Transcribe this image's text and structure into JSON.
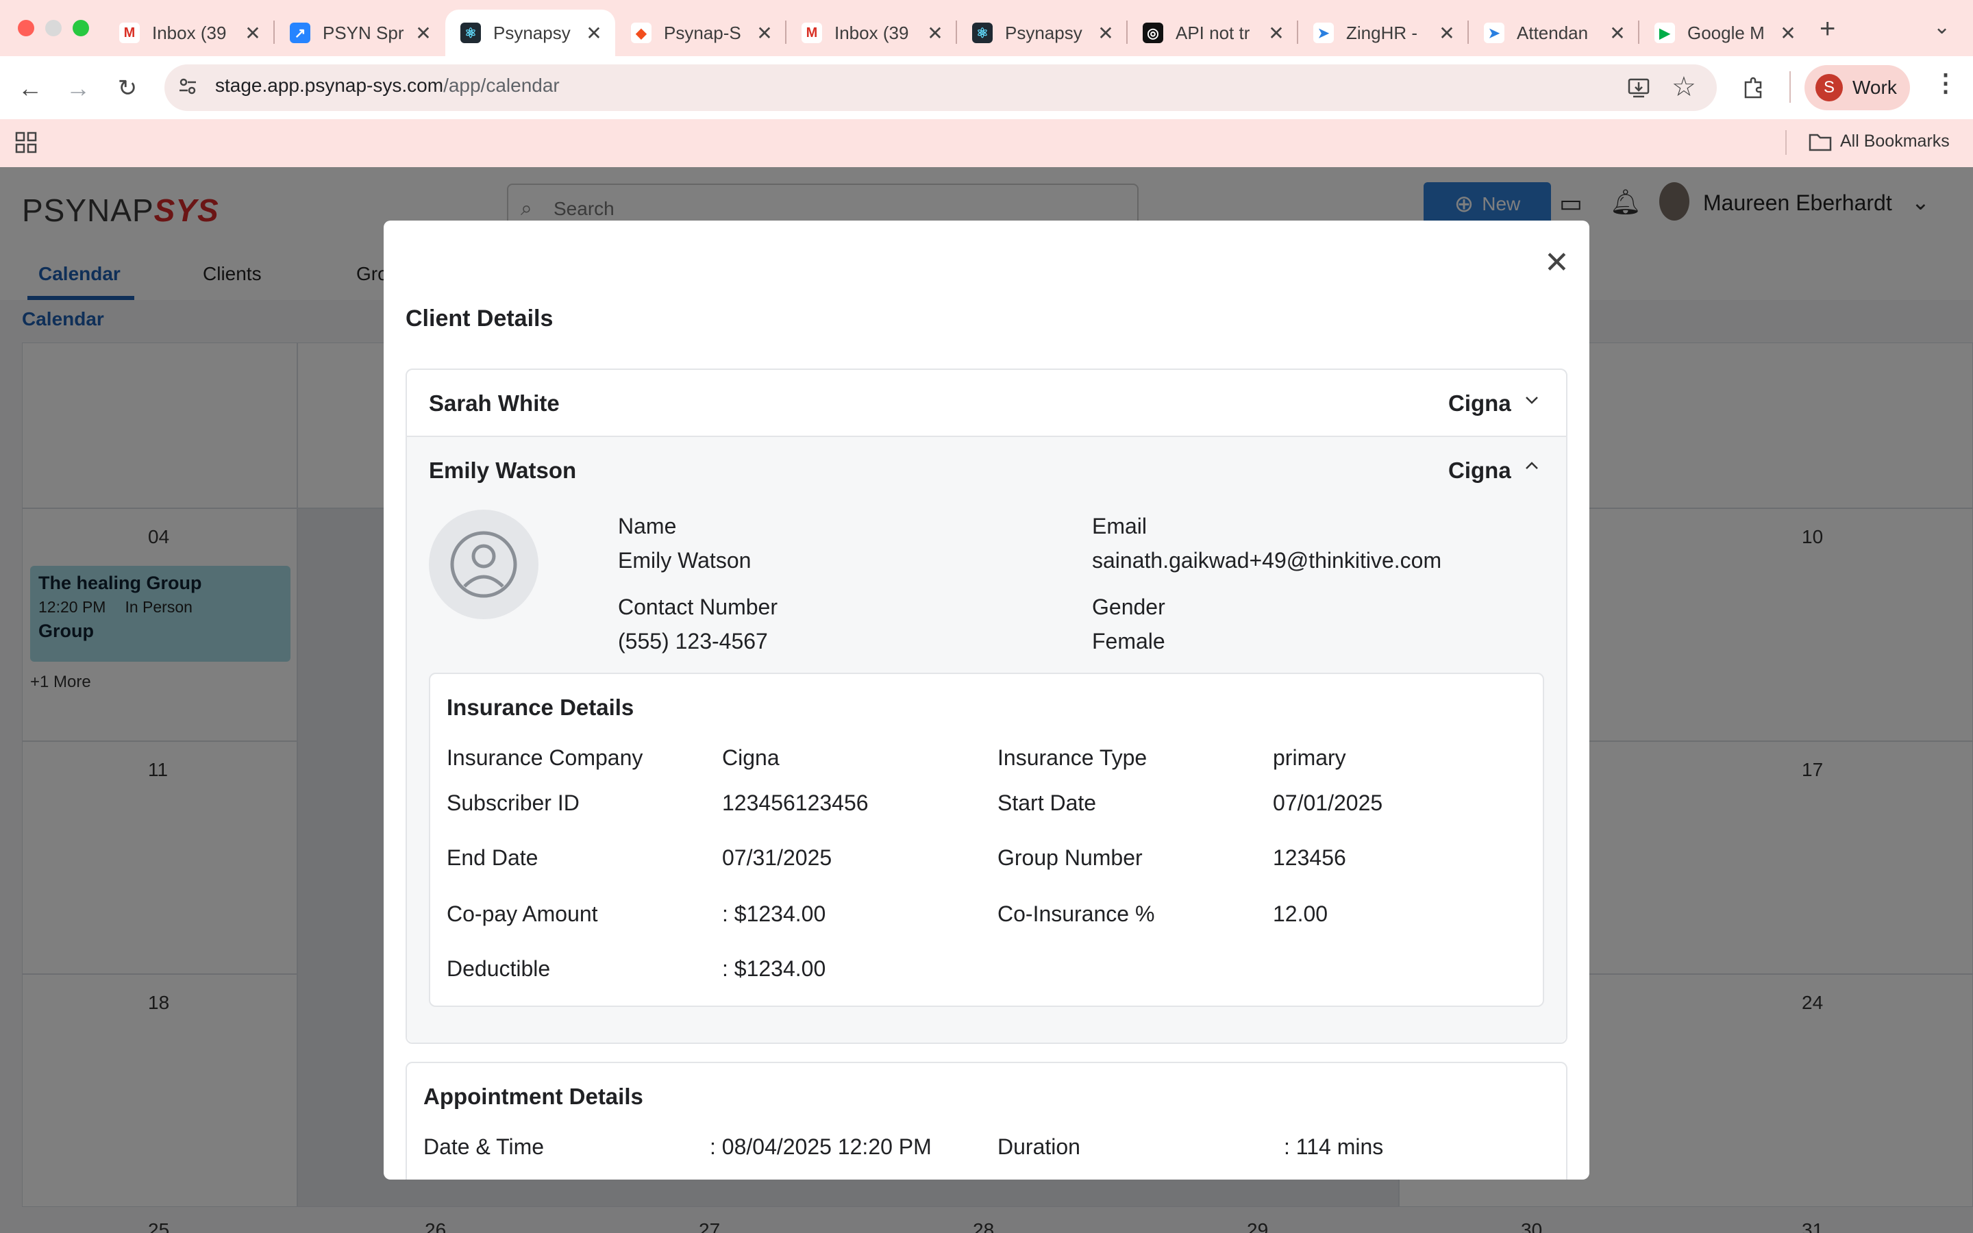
{
  "browser": {
    "tabs": [
      {
        "title": "Inbox (39",
        "icon": "gmail-icon",
        "active": false
      },
      {
        "title": "PSYN Spr",
        "icon": "jira-icon",
        "active": false
      },
      {
        "title": "Psynapsy",
        "icon": "react-icon",
        "active": true
      },
      {
        "title": "Psynap-S",
        "icon": "figma-icon",
        "active": false
      },
      {
        "title": "Inbox (39",
        "icon": "gmail-icon",
        "active": false
      },
      {
        "title": "Psynapsy",
        "icon": "react-icon",
        "active": false
      },
      {
        "title": "API not tr",
        "icon": "openai-icon",
        "active": false
      },
      {
        "title": "ZingHR -",
        "icon": "zinghr-icon",
        "active": false
      },
      {
        "title": "Attendan",
        "icon": "zinghr-icon",
        "active": false
      },
      {
        "title": "Google M",
        "icon": "google-meet-icon",
        "active": false
      }
    ],
    "url_host": "stage.app.psynap-sys.com",
    "url_path": "/app/calendar",
    "profile_initial": "S",
    "profile_label": "Work",
    "bookmarks_label": "All Bookmarks"
  },
  "app": {
    "logo_left": "PSYNAP",
    "logo_right": "SYS",
    "search_placeholder": "Search",
    "new_button": "New",
    "user_name": "Maureen Eberhardt",
    "nav_tabs": [
      "Calendar",
      "Clients",
      "Gro"
    ],
    "breadcrumb": "Calendar",
    "calendar": {
      "left_days": [
        {
          "row": 1,
          "day": "04"
        },
        {
          "row": 2,
          "day": "11"
        },
        {
          "row": 3,
          "day": "18"
        },
        {
          "row": 4,
          "day": "25"
        }
      ],
      "right_days": [
        {
          "row": 1,
          "day": "10"
        },
        {
          "row": 2,
          "day": "17"
        },
        {
          "row": 3,
          "day": "24"
        },
        {
          "row": 4,
          "day": "31"
        }
      ],
      "bottom_row_days": [
        "26",
        "27",
        "28",
        "29",
        "30"
      ],
      "event": {
        "title": "The healing Group",
        "time": "12:20 PM",
        "mode": "In Person",
        "type": "Group"
      },
      "more": "+1 More"
    }
  },
  "modal": {
    "title": "Client Details",
    "clients": [
      {
        "name": "Sarah White",
        "insurance": "Cigna",
        "expanded": false
      },
      {
        "name": "Emily Watson",
        "insurance": "Cigna",
        "expanded": true
      }
    ],
    "profile": {
      "name_label": "Name",
      "name_value": "Emily Watson",
      "email_label": "Email",
      "email_value": "sainath.gaikwad+49@thinkitive.com",
      "contact_label": "Contact Number",
      "contact_value": "(555) 123-4567",
      "gender_label": "Gender",
      "gender_value": "Female"
    },
    "insurance": {
      "heading": "Insurance Details",
      "rows": [
        [
          {
            "label": "Insurance Company",
            "value": "Cigna"
          },
          {
            "label": "Insurance Type",
            "value": "primary"
          }
        ],
        [
          {
            "label": "Subscriber ID",
            "value": "123456123456"
          },
          {
            "label": "Start Date",
            "value": "07/01/2025"
          }
        ],
        [
          {
            "label": "End Date",
            "value": "07/31/2025"
          },
          {
            "label": "Group Number",
            "value": "123456"
          }
        ],
        [
          {
            "label": "Co-pay Amount",
            "value": ": $1234.00"
          },
          {
            "label": "Co-Insurance %",
            "value": "12.00"
          }
        ],
        [
          {
            "label": "Deductible",
            "value": ": $1234.00"
          }
        ]
      ]
    },
    "appointment": {
      "heading": "Appointment Details",
      "date_label": "Date & Time",
      "date_value": ": 08/04/2025 12:20 PM",
      "duration_label": "Duration",
      "duration_value": ": 114 mins"
    }
  }
}
